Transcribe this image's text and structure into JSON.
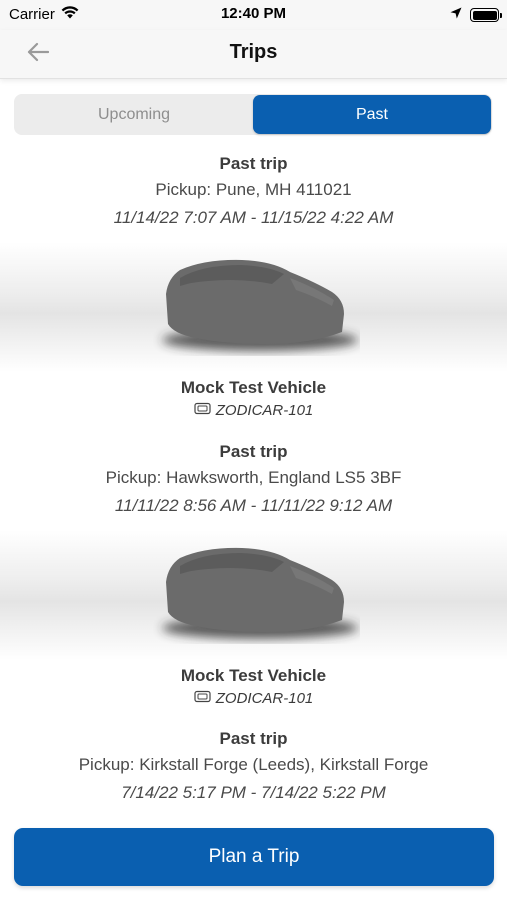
{
  "status_bar": {
    "carrier": "Carrier",
    "time": "12:40 PM"
  },
  "nav": {
    "title": "Trips"
  },
  "tabs": [
    {
      "label": "Upcoming",
      "selected": false
    },
    {
      "label": "Past",
      "selected": true
    }
  ],
  "trips": [
    {
      "heading": "Past trip",
      "pickup": "Pickup: Pune, MH 411021",
      "dates": "11/14/22 7:07 AM - 11/15/22 4:22 AM",
      "vehicle": {
        "name": "Mock Test Vehicle",
        "plate": "ZODICAR-101"
      }
    },
    {
      "heading": "Past trip",
      "pickup": "Pickup: Hawksworth, England LS5 3BF",
      "dates": "11/11/22 8:56 AM - 11/11/22 9:12 AM",
      "vehicle": {
        "name": "Mock Test Vehicle",
        "plate": "ZODICAR-101"
      }
    },
    {
      "heading": "Past trip",
      "pickup": "Pickup: Kirkstall Forge (Leeds), Kirkstall Forge",
      "dates": "7/14/22 5:17 PM - 7/14/22 5:22 PM"
    }
  ],
  "actions": {
    "plan_trip": "Plan a Trip"
  },
  "colors": {
    "accent": "#0a5fb0",
    "nav_background": "#f7f7f7",
    "tab_track": "#ececec"
  },
  "icons": [
    "wifi-icon",
    "location-arrow-icon",
    "battery-icon",
    "back-arrow-icon",
    "car-silhouette-icon",
    "license-plate-icon"
  ]
}
